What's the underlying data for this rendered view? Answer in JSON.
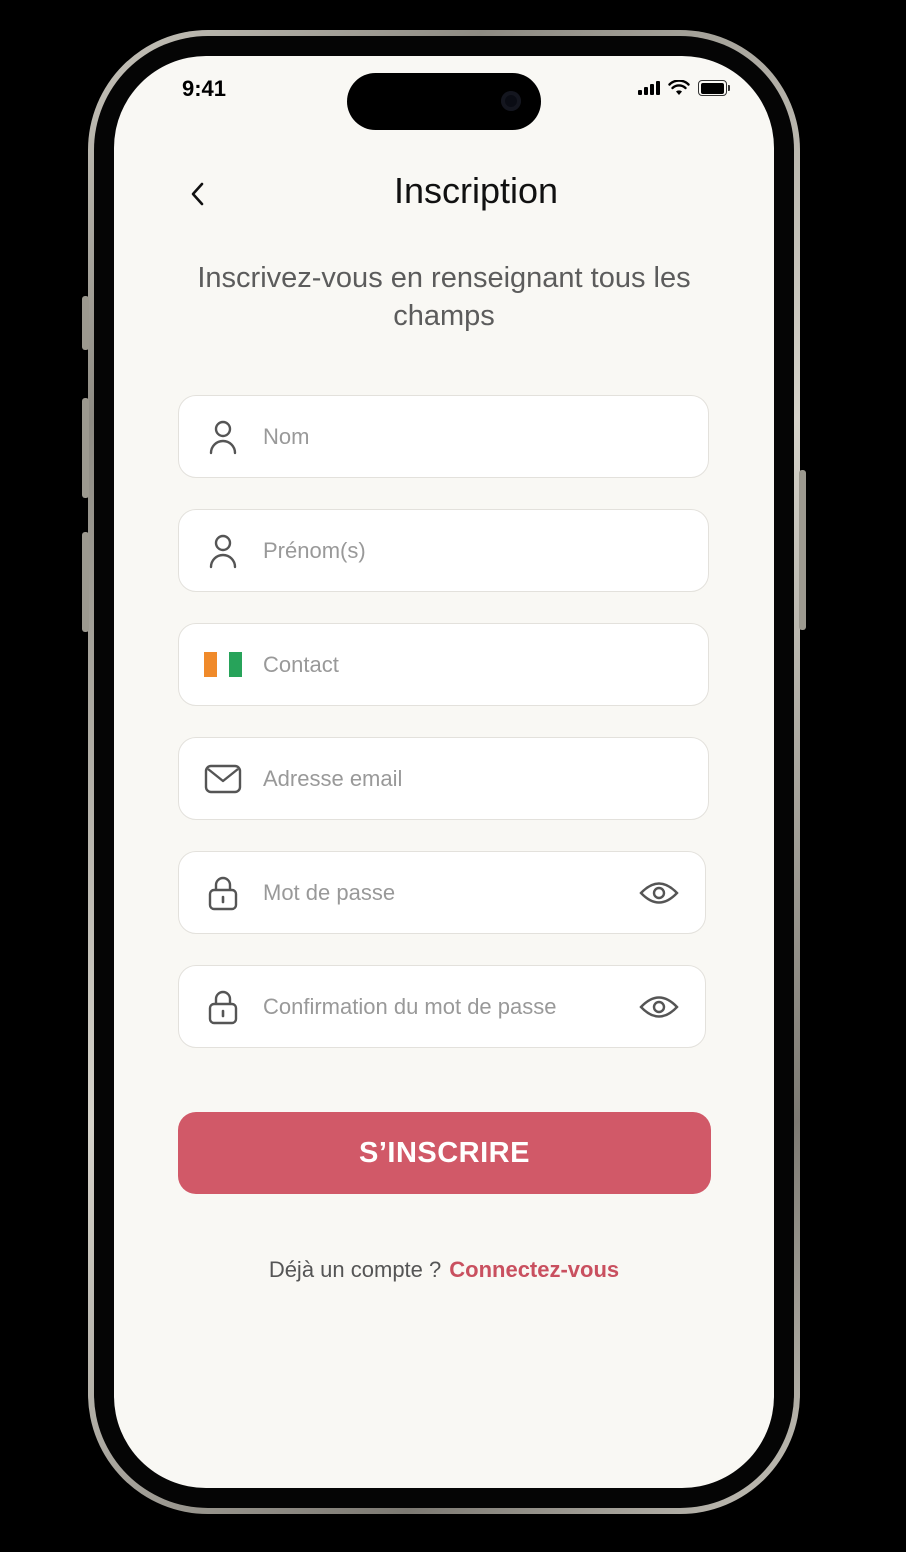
{
  "status_bar": {
    "time": "9:41"
  },
  "header": {
    "title": "Inscription",
    "back_icon": "chevron-left-icon"
  },
  "subtitle": "Inscrivez-vous en renseignant tous les champs",
  "form": {
    "fields": [
      {
        "icon": "user-icon",
        "placeholder": "Nom",
        "value": ""
      },
      {
        "icon": "user-icon",
        "placeholder": "Prénom(s)",
        "value": ""
      },
      {
        "icon": "flag-cote-divoire-icon",
        "placeholder": "Contact",
        "value": ""
      },
      {
        "icon": "mail-icon",
        "placeholder": "Adresse email",
        "value": ""
      },
      {
        "icon": "lock-icon",
        "placeholder": "Mot de passe",
        "value": "",
        "trailing_icon": "eye-icon"
      },
      {
        "icon": "lock-icon",
        "placeholder": "Confirmation du mot de passe",
        "value": "",
        "trailing_icon": "eye-icon"
      }
    ],
    "submit_label": "S’INSCRIRE"
  },
  "footer": {
    "prompt": "Déjà un compte ?",
    "link_label": "Connectez-vous"
  },
  "colors": {
    "accent": "#d15968",
    "link": "#c9505f",
    "background": "#f9f8f4",
    "flag": [
      "#f08a2a",
      "#ffffff",
      "#27a35a"
    ]
  }
}
